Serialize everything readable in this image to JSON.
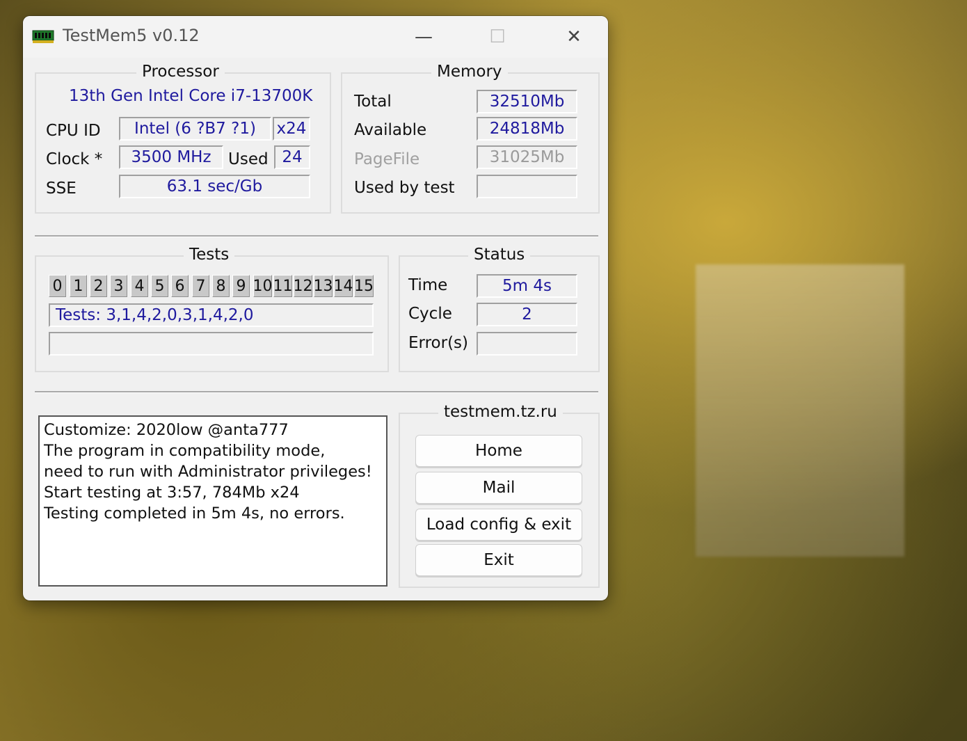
{
  "window": {
    "title": "TestMem5 v0.12",
    "controls": {
      "minimize": "—",
      "maximize": "☐",
      "close": "✕"
    }
  },
  "processor": {
    "legend": "Processor",
    "name": "13th Gen Intel Core i7-13700K",
    "cpu_id_label": "CPU ID",
    "cpu_id_value": "Intel  (6 ?B7 ?1)",
    "threads": "x24",
    "clock_label": "Clock *",
    "clock_value": "3500 MHz",
    "used_label": "Used",
    "used_value": "24",
    "sse_label": "SSE",
    "sse_value": "63.1 sec/Gb"
  },
  "memory": {
    "legend": "Memory",
    "total_label": "Total",
    "total_value": "32510Mb",
    "available_label": "Available",
    "available_value": "24818Mb",
    "pagefile_label": "PageFile",
    "pagefile_value": "31025Mb",
    "used_by_test_label": "Used by test",
    "used_by_test_value": ""
  },
  "tests": {
    "legend": "Tests",
    "cells": [
      "0",
      "1",
      "2",
      "3",
      "4",
      "5",
      "6",
      "7",
      "8",
      "9",
      "10",
      "11",
      "12",
      "13",
      "14",
      "15"
    ],
    "sequence": "Tests: 3,1,4,2,0,3,1,4,2,0",
    "progress": ""
  },
  "status": {
    "legend": "Status",
    "time_label": "Time",
    "time_value": "5m 4s",
    "cycle_label": "Cycle",
    "cycle_value": "2",
    "errors_label": "Error(s)",
    "errors_value": ""
  },
  "log": [
    "Customize: 2020low @anta777",
    "The program in compatibility mode,",
    "need to run with Administrator privileges!",
    "Start testing at 3:57, 784Mb x24",
    "Testing completed in 5m 4s, no errors."
  ],
  "links": {
    "legend": "testmem.tz.ru",
    "home": "Home",
    "mail": "Mail",
    "load_config": "Load config & exit",
    "exit": "Exit"
  },
  "colors": {
    "value_text": "#1f1a9e",
    "window_bg": "#f0f0f0"
  }
}
